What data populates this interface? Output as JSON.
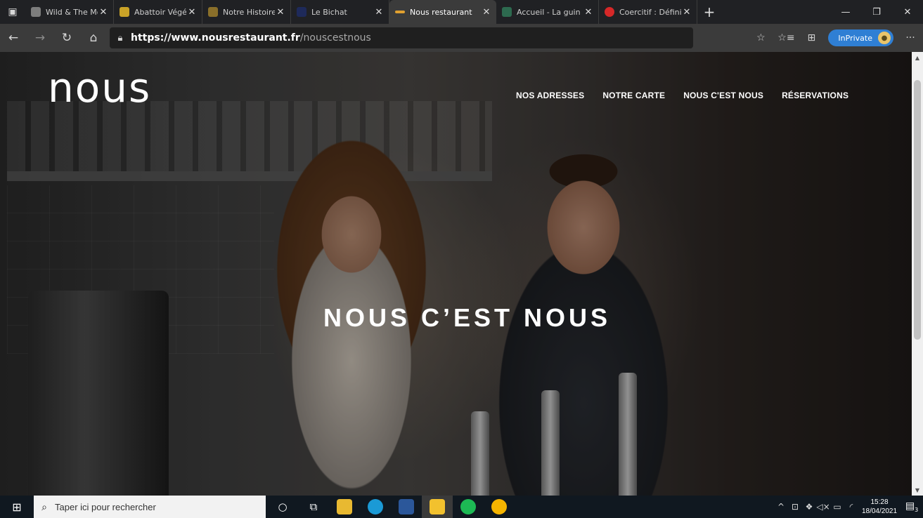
{
  "browser": {
    "tabs": [
      {
        "title": "Wild & The Moo",
        "favicon_color": "#7d7d7d",
        "active": false
      },
      {
        "title": "Abattoir Végétal",
        "favicon_color": "#c9a227",
        "active": false
      },
      {
        "title": "Notre Histoire | ",
        "favicon_color": "#8a6f2a",
        "active": false
      },
      {
        "title": "Le Bichat",
        "favicon_color": "#1e2a5a",
        "active": false
      },
      {
        "title": "Nous restaurant",
        "favicon_color": "#e0a030",
        "active": true
      },
      {
        "title": "Accueil - La guin",
        "favicon_color": "#2d6a4f",
        "active": false
      },
      {
        "title": "Coercitif : Définit",
        "favicon_color": "#d62828",
        "active": false
      }
    ],
    "new_tab_glyph": "+",
    "address": {
      "scheme": "https://",
      "host": "www.nousrestaurant.fr",
      "path": "/nouscestnous"
    },
    "inprivate_label": "InPrivate",
    "more_glyph": "···"
  },
  "site": {
    "logo": "nous",
    "nav": [
      "NOS ADRESSES",
      "NOTRE CARTE",
      "NOUS C'EST NOUS",
      "RÉSERVATIONS"
    ],
    "hero_title": "NOUS C’EST NOUS"
  },
  "taskbar": {
    "search_placeholder": "Taper ici pour rechercher",
    "time": "15:28",
    "date": "18/04/2021",
    "notification_count": "3"
  }
}
